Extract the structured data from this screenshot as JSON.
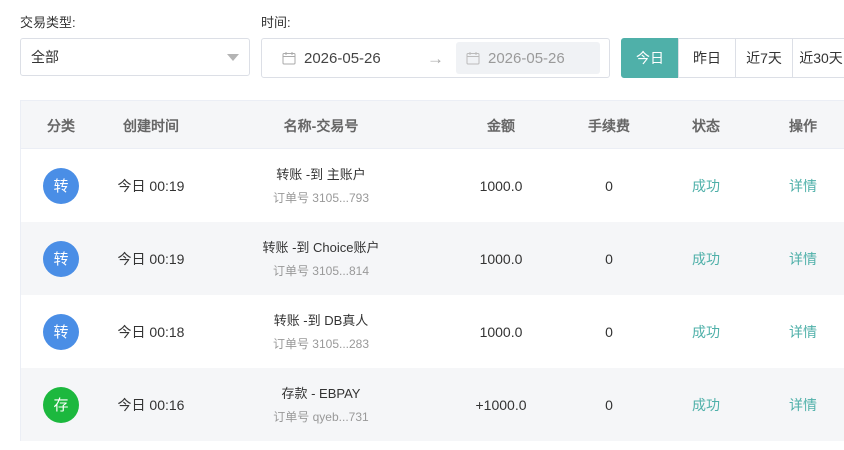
{
  "filters": {
    "type_label": "交易类型:",
    "type_value": "全部",
    "time_label": "时间:",
    "date_start": "2026-05-26",
    "date_separator": "→",
    "date_end": "2026-05-26",
    "quick_ranges": [
      "今日",
      "昨日",
      "近7天",
      "近30天"
    ],
    "active_range": "今日"
  },
  "table": {
    "headers": [
      "分类",
      "创建时间",
      "名称-交易号",
      "金额",
      "手续费",
      "状态",
      "操作"
    ],
    "rows": [
      {
        "category": "转",
        "category_color": "#4a8ee6",
        "time": "今日 00:19",
        "name": "转账 -到 主账户",
        "order": "订单号 3105...793",
        "amount": "1000.0",
        "fee": "0",
        "status": "成功",
        "action": "详情"
      },
      {
        "category": "转",
        "category_color": "#4a8ee6",
        "time": "今日 00:19",
        "name": "转账 -到 Choice账户",
        "order": "订单号 3105...814",
        "amount": "1000.0",
        "fee": "0",
        "status": "成功",
        "action": "详情"
      },
      {
        "category": "转",
        "category_color": "#4a8ee6",
        "time": "今日 00:18",
        "name": "转账 -到 DB真人",
        "order": "订单号 3105...283",
        "amount": "1000.0",
        "fee": "0",
        "status": "成功",
        "action": "详情"
      },
      {
        "category": "存",
        "category_color": "#1cb83e",
        "time": "今日 00:16",
        "name": "存款 - EBPAY",
        "order": "订单号 qyeb...731",
        "amount": "+1000.0",
        "fee": "0",
        "status": "成功",
        "action": "详情"
      }
    ]
  },
  "colors": {
    "accent": "#4fb0a9",
    "transfer": "#4a8ee6",
    "deposit": "#1cb83e"
  }
}
